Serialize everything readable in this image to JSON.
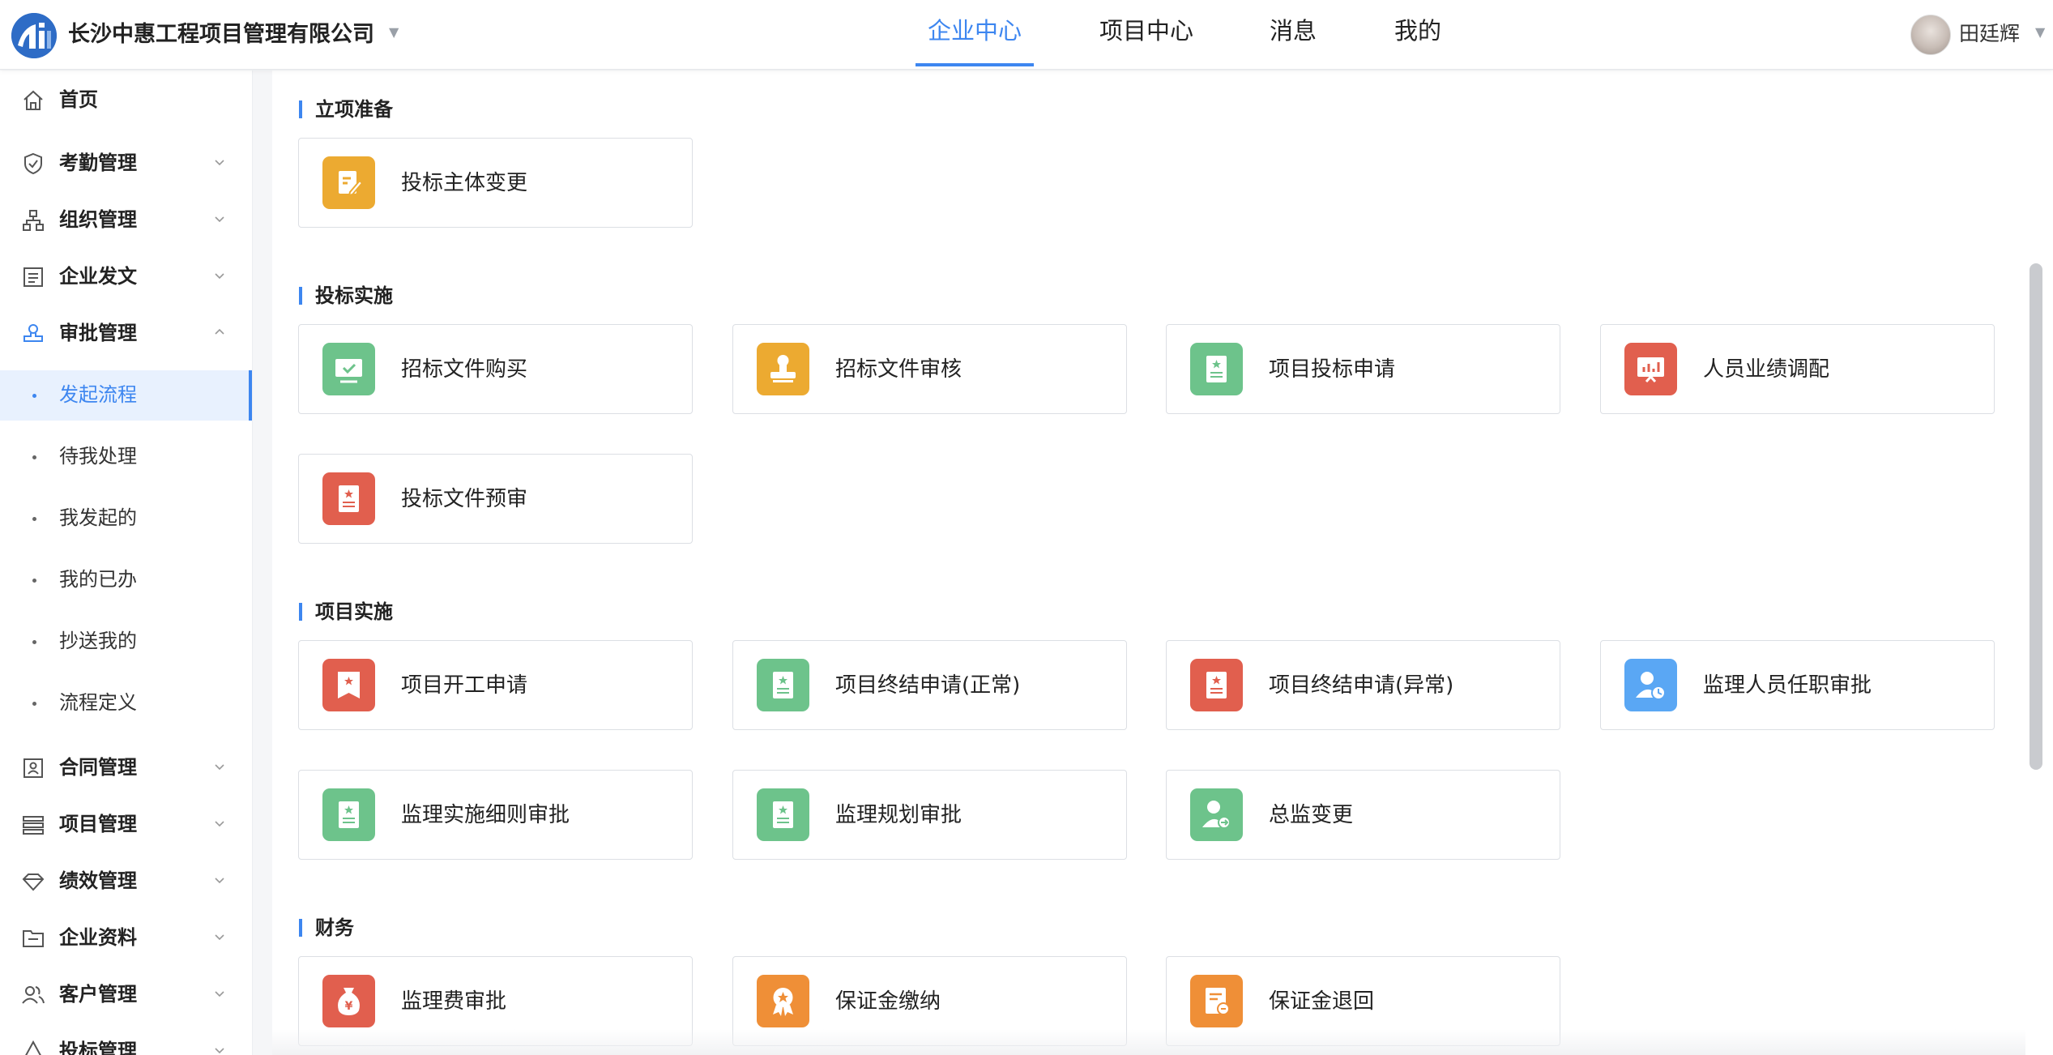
{
  "header": {
    "company_name": "长沙中惠工程项目管理有限公司",
    "nav_tabs": [
      {
        "label": "企业中心",
        "active": true
      },
      {
        "label": "项目中心",
        "active": false
      },
      {
        "label": "消息",
        "active": false
      },
      {
        "label": "我的",
        "active": false
      }
    ],
    "user_name": "田廷辉"
  },
  "sidebar": {
    "items": [
      {
        "label": "首页",
        "icon": "home-icon"
      },
      {
        "label": "考勤管理",
        "icon": "shield-check-icon",
        "expandable": true
      },
      {
        "label": "组织管理",
        "icon": "org-chart-icon",
        "expandable": true
      },
      {
        "label": "企业发文",
        "icon": "document-icon",
        "expandable": true
      },
      {
        "label": "审批管理",
        "icon": "stamp-icon",
        "expandable": true,
        "expanded": true
      },
      {
        "label": "合同管理",
        "icon": "contract-icon",
        "expandable": true
      },
      {
        "label": "项目管理",
        "icon": "list-icon",
        "expandable": true
      },
      {
        "label": "绩效管理",
        "icon": "diamond-icon",
        "expandable": true
      },
      {
        "label": "企业资料",
        "icon": "folder-icon",
        "expandable": true
      },
      {
        "label": "客户管理",
        "icon": "people-icon",
        "expandable": true
      },
      {
        "label": "投标管理",
        "icon": "bid-icon",
        "expandable": true
      }
    ],
    "sub_items": [
      {
        "label": "发起流程",
        "active": true
      },
      {
        "label": "待我处理",
        "active": false
      },
      {
        "label": "我发起的",
        "active": false
      },
      {
        "label": "我的已办",
        "active": false
      },
      {
        "label": "抄送我的",
        "active": false
      },
      {
        "label": "流程定义",
        "active": false
      }
    ]
  },
  "sections": [
    {
      "title": "立项准备",
      "cards": [
        {
          "label": "投标主体变更",
          "color": "#ecaa31",
          "icon": "edit-document-icon"
        }
      ]
    },
    {
      "title": "投标实施",
      "cards": [
        {
          "label": "招标文件购买",
          "color": "#6dc38b",
          "icon": "presentation-check-icon"
        },
        {
          "label": "招标文件审核",
          "color": "#ecaa31",
          "icon": "stamp-icon"
        },
        {
          "label": "项目投标申请",
          "color": "#6dc38b",
          "icon": "star-document-icon"
        },
        {
          "label": "人员业绩调配",
          "color": "#e15f4e",
          "icon": "chart-board-icon"
        },
        {
          "label": "投标文件预审",
          "color": "#e15f4e",
          "icon": "star-document-icon"
        }
      ]
    },
    {
      "title": "项目实施",
      "cards": [
        {
          "label": "项目开工申请",
          "color": "#e15f4e",
          "icon": "ribbon-document-icon"
        },
        {
          "label": "项目终结申请(正常)",
          "color": "#6dc38b",
          "icon": "star-document-icon"
        },
        {
          "label": "项目终结申请(异常)",
          "color": "#e15f4e",
          "icon": "star-document-icon"
        },
        {
          "label": "监理人员任职审批",
          "color": "#5aa7f4",
          "icon": "user-clock-icon"
        },
        {
          "label": "监理实施细则审批",
          "color": "#6dc38b",
          "icon": "star-document-icon"
        },
        {
          "label": "监理规划审批",
          "color": "#6dc38b",
          "icon": "star-document-icon"
        },
        {
          "label": "总监变更",
          "color": "#6dc38b",
          "icon": "user-swap-icon"
        }
      ]
    },
    {
      "title": "财务",
      "cards": [
        {
          "label": "监理费审批",
          "color": "#e15f4e",
          "icon": "money-bag-icon"
        },
        {
          "label": "保证金缴纳",
          "color": "#ef8f37",
          "icon": "award-icon"
        },
        {
          "label": "保证金退回",
          "color": "#ef8f37",
          "icon": "refund-document-icon"
        }
      ]
    }
  ]
}
